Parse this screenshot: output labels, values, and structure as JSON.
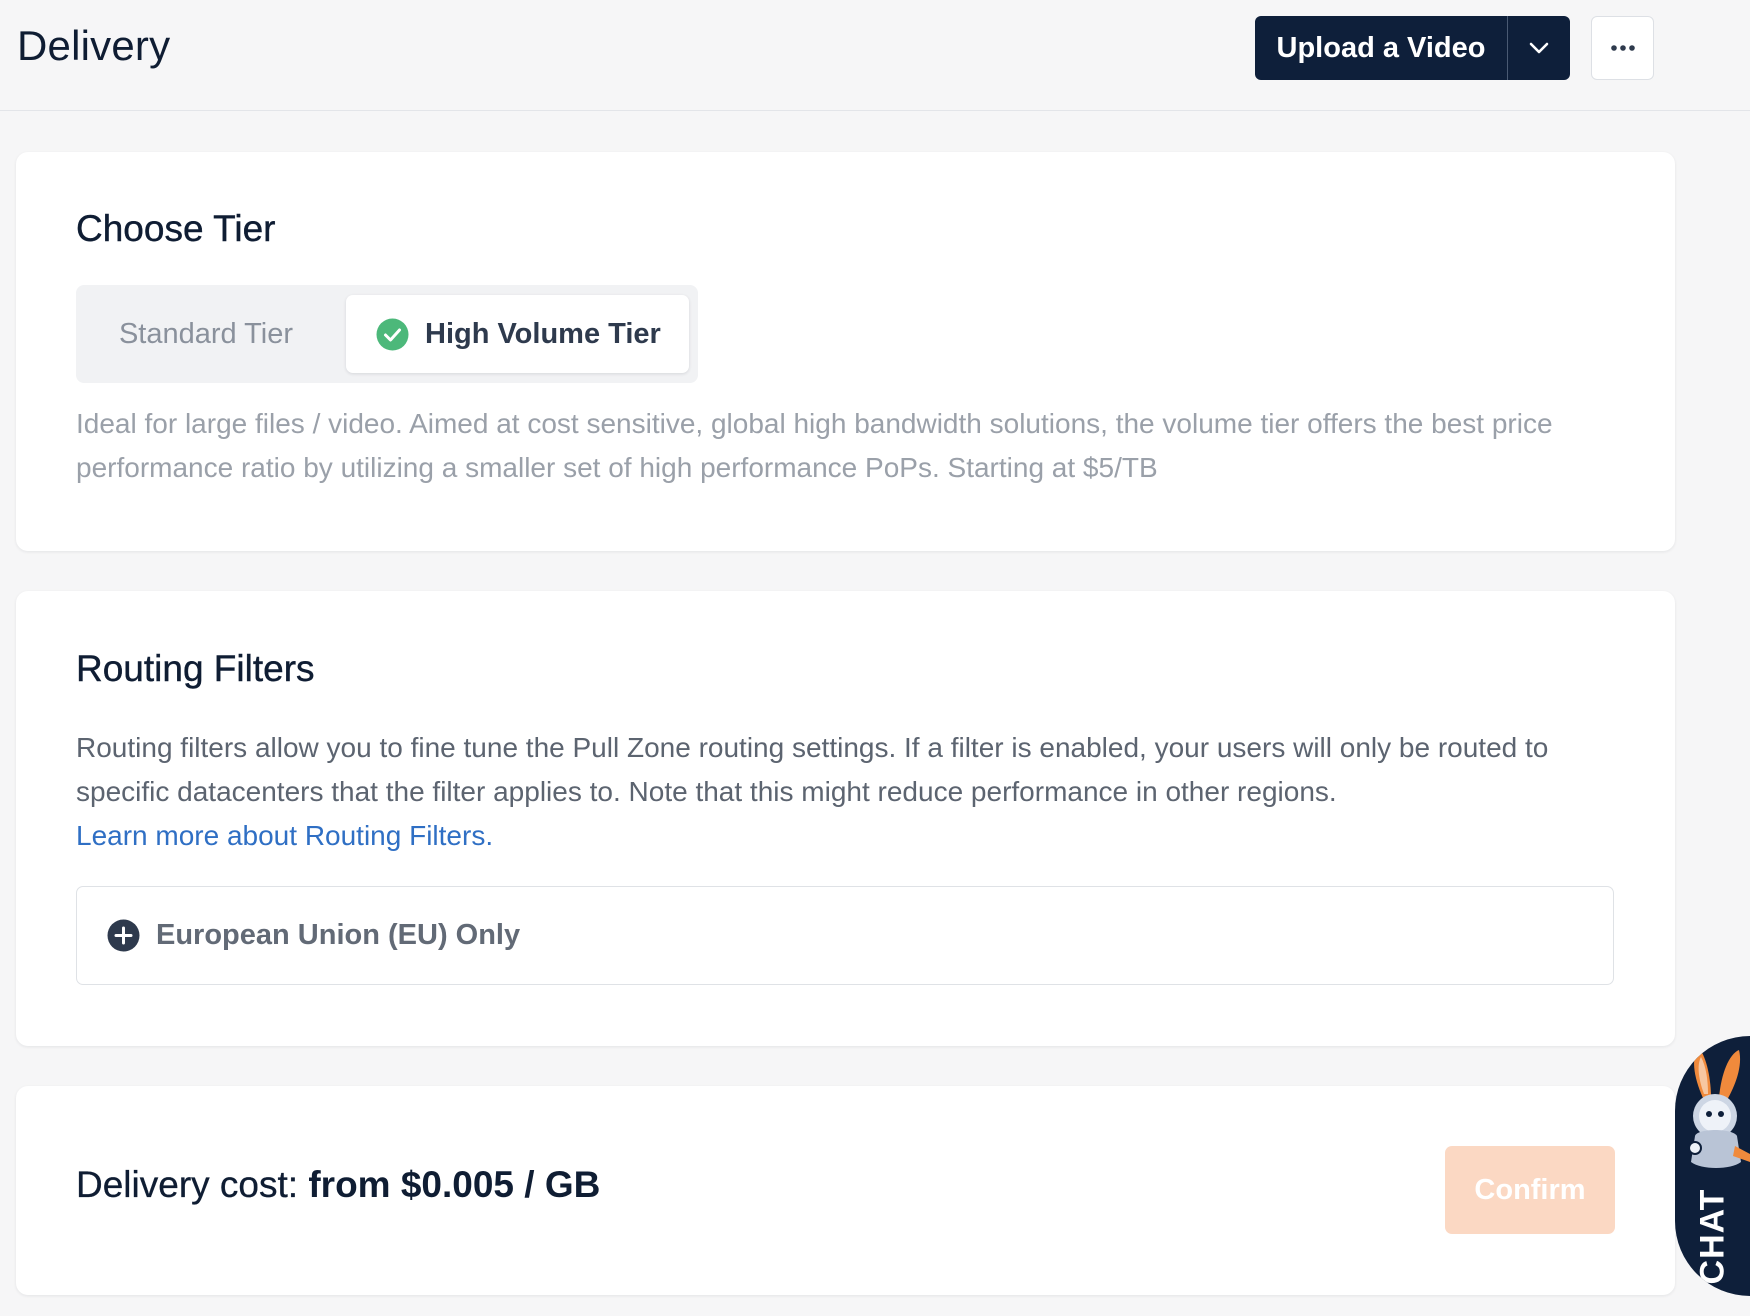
{
  "header": {
    "title": "Delivery",
    "upload_label": "Upload a Video",
    "caret_icon": "chevron-down-icon",
    "more_icon": "ellipsis-icon"
  },
  "tier": {
    "heading": "Choose Tier",
    "options": [
      {
        "label": "Standard Tier",
        "selected": false
      },
      {
        "label": "High Volume Tier",
        "selected": true
      }
    ],
    "selected_icon": "check-circle-icon",
    "description": "Ideal for large files / video. Aimed at cost sensitive, global high bandwidth solutions, the volume tier offers the best price performance ratio by utilizing a smaller set of high performance PoPs. Starting at $5/TB"
  },
  "routing": {
    "heading": "Routing Filters",
    "description": "Routing filters allow you to fine tune the Pull Zone routing settings. If a filter is enabled, your users will only be routed to specific datacenters that the filter applies to. Note that this might reduce performance in other regions.",
    "link_label": "Learn more about Routing Filters",
    "link_suffix": ".",
    "filters": [
      {
        "label": "European Union (EU) Only",
        "icon": "plus-circle-icon"
      }
    ]
  },
  "cost": {
    "label": "Delivery cost: ",
    "value": "from $0.005 / GB",
    "confirm_label": "Confirm"
  },
  "chat": {
    "label": "CHAT",
    "mascot": "bunny-mascot-icon"
  },
  "colors": {
    "navy": "#0e1f3a",
    "success": "#4cb87a",
    "link": "#2f6fc4",
    "confirm_disabled": "#fbd8c3",
    "mascot_orange": "#f08a3c"
  }
}
